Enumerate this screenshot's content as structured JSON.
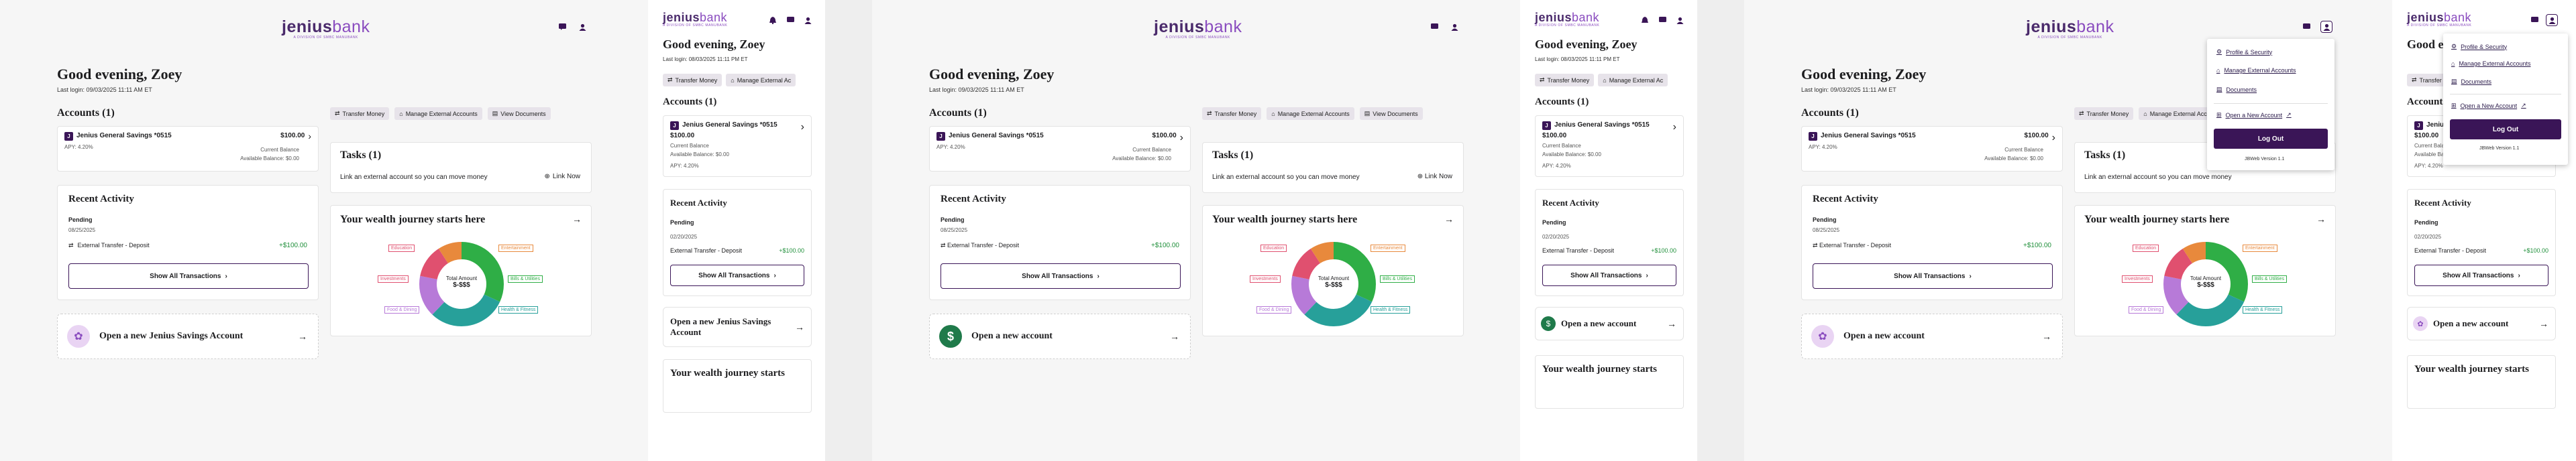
{
  "brand": {
    "wordmark_a": "jenius",
    "wordmark_b": "bank",
    "tagline": "A DIVISION OF SMBC MANUBANK"
  },
  "greeting": "Good evening, Zoey",
  "last_login_desktop": "Last login: 09/03/2025 11:11 AM ET",
  "last_login_mobile": "Last login: 08/03/2025 11:11 PM ET",
  "accounts_title": "Accounts (1)",
  "actions": {
    "transfer": "Transfer Money",
    "manage": "Manage External Accounts",
    "manage_cut": "Manage External Ac",
    "docs": "View Documents"
  },
  "account": {
    "name": "Jenius General Savings *0515",
    "balance": "$100.00",
    "apy": "APY: 4.20%",
    "current_label": "Current Balance",
    "available": "Available Balance: $0.00"
  },
  "tasks": {
    "title": "Tasks (1)",
    "text": "Link an external account so you can move money",
    "link": "Link Now"
  },
  "activity": {
    "title": "Recent Activity",
    "pending": "Pending",
    "date_desktop": "08/25/2025",
    "date_mobile": "02/20/2025",
    "desc": "External Transfer - Deposit",
    "amount": "+$100.00",
    "show_all": "Show All Transactions"
  },
  "open_account": {
    "savings": "Open a new Jenius Savings Account",
    "savings_mobile": "Open a new Jenius Savings Account",
    "generic": "Open a new account"
  },
  "wealth": {
    "title": "Your wealth journey starts here",
    "title_mobile": "Your wealth journey starts",
    "center_1": "Total Amount",
    "center_2": "$-$$$",
    "labels": {
      "education": "Education",
      "entertainment": "Entertainment",
      "investments": "Investments",
      "bills": "Bills & Utilities",
      "food": "Food & Dining",
      "health": "Health & Fitness"
    }
  },
  "menu": {
    "profile": "Profile & Security",
    "manage": "Manage External Accounts",
    "documents": "Documents",
    "open_new": "Open a New Account",
    "logout": "Log Out",
    "version": "JBWeb Version 1.1"
  },
  "colors": {
    "brand": "#3a1557",
    "accent": "#8a4cbf",
    "green": "#1f8f3a"
  }
}
